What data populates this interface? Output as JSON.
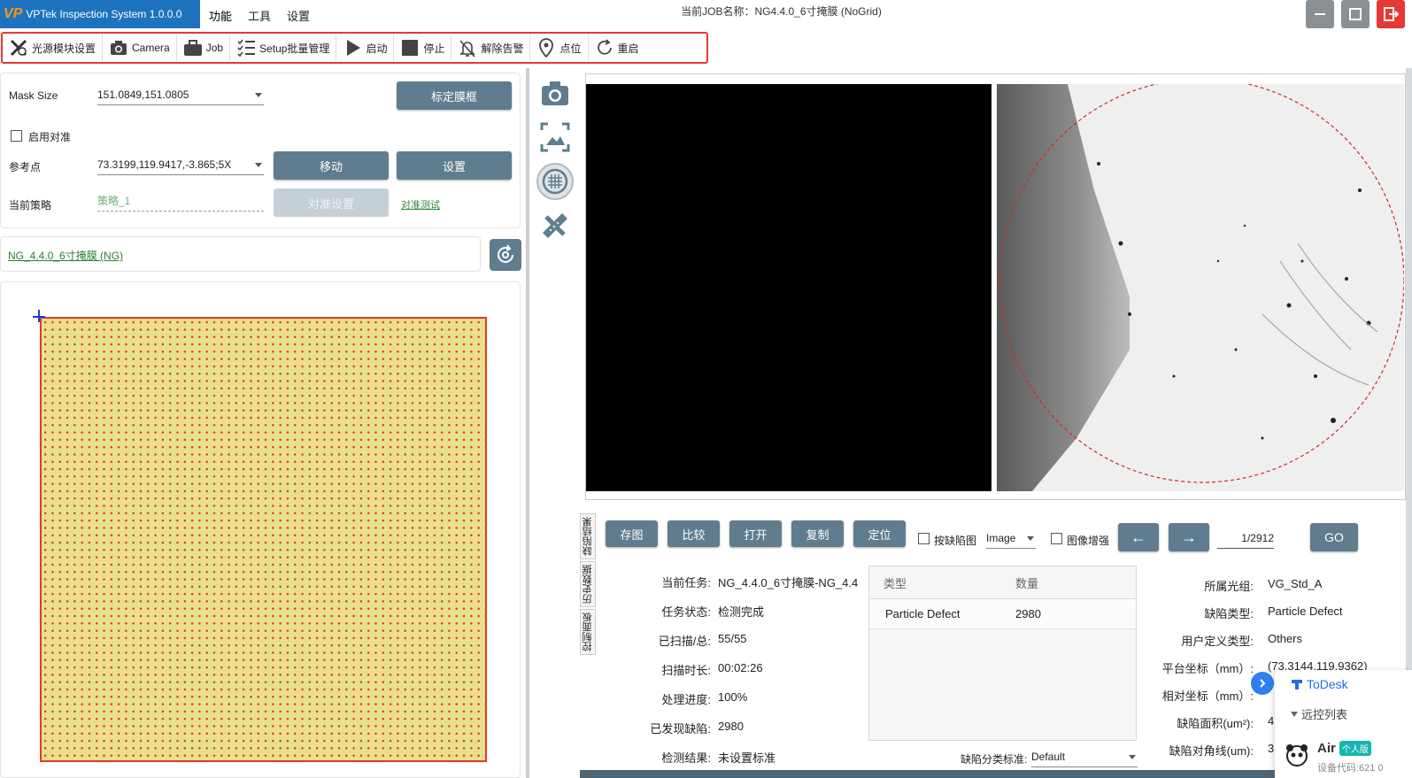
{
  "titlebar": {
    "logo": "VP",
    "app_name": "VPTek Inspection System 1.0.0.0",
    "menus": [
      "功能",
      "工具",
      "设置"
    ],
    "job_title": "当前JOB名称：NG4.4.0_6寸掩膜 (NoGrid)"
  },
  "toolbar": {
    "items": [
      "光源模块设置",
      "Camera",
      "Job",
      "Setup批量管理",
      "启动",
      "停止",
      "解除告警",
      "点位",
      "重启"
    ]
  },
  "left": {
    "mask_size_label": "Mask Size",
    "mask_size_value": "151.0849,151.0805",
    "calibrate_button": "标定膜框",
    "enable_align_label": "启用对准",
    "ref_point_label": "参考点",
    "ref_point_value": "73.3199,119.9417,-3.865;5X",
    "move_button": "移动",
    "set_button": "设置",
    "strategy_label": "当前策略",
    "strategy_value": "策略_1",
    "align_setting_button": "对准设置",
    "align_test_link": "对准测试",
    "job_link": "NG_4.4.0_6寸掩膜 (NG)"
  },
  "actions": {
    "buttons": [
      "存图",
      "比较",
      "打开",
      "复制",
      "定位"
    ],
    "defect_map_label": "按缺陷图",
    "image_mode": "Image",
    "enhance_label": "图像增强",
    "prev": "←",
    "next": "→",
    "page": "1/2912",
    "go": "GO"
  },
  "vtabs": [
    "缺陷结果",
    "历史数据",
    "控制面板"
  ],
  "task": {
    "labels": [
      "当前任务:",
      "任务状态:",
      "已扫描/总:",
      "扫描时长:",
      "处理进度:",
      "已发现缺陷:",
      "检测结果:"
    ],
    "values": [
      "NG_4.4.0_6寸掩膜-NG_4.4",
      "检测完成",
      "55/55",
      "00:02:26",
      "100%",
      "2980",
      "未设置标准"
    ]
  },
  "defect_table": {
    "headers": [
      "类型",
      "数量"
    ],
    "rows": [
      [
        "Particle Defect",
        "2980"
      ]
    ]
  },
  "classify": {
    "label": "缺陷分类标准:",
    "value": "Default"
  },
  "defect_info": {
    "labels": [
      "所属光组:",
      "缺陷类型:",
      "用户定义类型:",
      "平台坐标（mm）:",
      "相对坐标（mm）:",
      "缺陷面积(um²):",
      "缺陷对角线(um):"
    ],
    "values": [
      "VG_Std_A",
      "Particle Defect",
      "Others",
      "(73.3144,119.9362)",
      "",
      "4",
      "3"
    ]
  },
  "todesk": {
    "title": "ToDesk",
    "remote_list": "远控列表",
    "device_name": "Air",
    "edition_badge": "个人版",
    "device_code": "设备代码:621 0"
  }
}
